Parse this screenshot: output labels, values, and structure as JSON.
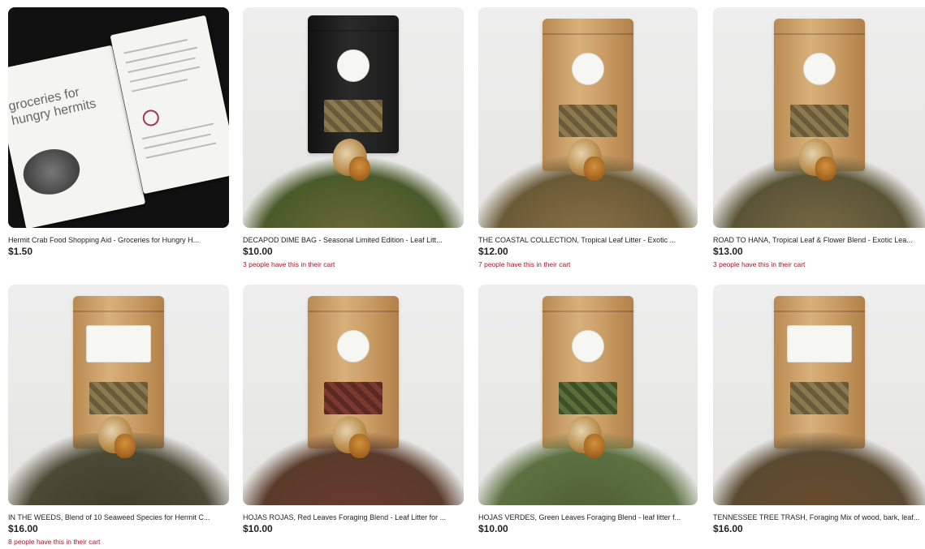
{
  "listings": [
    {
      "title": "Hermit Crab Food Shopping Aid - Groceries for Hungry H...",
      "price": "$1.50",
      "cart_note": "",
      "image": {
        "kind": "pamphlet",
        "text_line1": "groceries for",
        "text_line2": "hungry hermits"
      }
    },
    {
      "title": "DECAPOD DIME BAG - Seasonal Limited Edition - Leaf Litt...",
      "price": "$10.00",
      "cart_note": "3 people have this in their cart",
      "image": {
        "kind": "bag",
        "bag_color": "#1a1a1a",
        "pile_color": "#6d6a3a"
      }
    },
    {
      "title": "THE COASTAL COLLECTION, Tropical Leaf Litter - Exotic ...",
      "price": "$12.00",
      "cart_note": "7 people have this in their cart",
      "image": {
        "kind": "bag",
        "bag_color": "#c89b63",
        "pile_color": "#8a7148"
      }
    },
    {
      "title": "ROAD TO HANA, Tropical Leaf & Flower Blend - Exotic Lea...",
      "price": "$13.00",
      "cart_note": "3 people have this in their cart",
      "image": {
        "kind": "bag",
        "bag_color": "#c89b63",
        "pile_color": "#7c6a45"
      }
    },
    {
      "title": "IN THE WEEDS, Blend of 10 Seaweed Species for Hermit C...",
      "price": "$16.00",
      "cart_note": "8 people have this in their cart",
      "image": {
        "kind": "bag",
        "bag_color": "#c89b63",
        "pile_color": "#3f3a2a"
      }
    },
    {
      "title": "HOJAS ROJAS, Red Leaves Foraging Blend - Leaf Litter for ...",
      "price": "$10.00",
      "cart_note": "",
      "image": {
        "kind": "bag",
        "bag_color": "#c89b63",
        "pile_color": "#6a3a2e"
      }
    },
    {
      "title": "HOJAS VERDES, Green Leaves Foraging Blend - leaf litter f...",
      "price": "$10.00",
      "cart_note": "",
      "image": {
        "kind": "bag",
        "bag_color": "#c89b63",
        "pile_color": "#4e5f34"
      }
    },
    {
      "title": "TENNESSEE TREE TRASH, Foraging Mix of wood, bark, leaf...",
      "price": "$16.00",
      "cart_note": "",
      "image": {
        "kind": "bag",
        "bag_color": "#c89b63",
        "pile_color": "#6a4a2c"
      }
    }
  ]
}
